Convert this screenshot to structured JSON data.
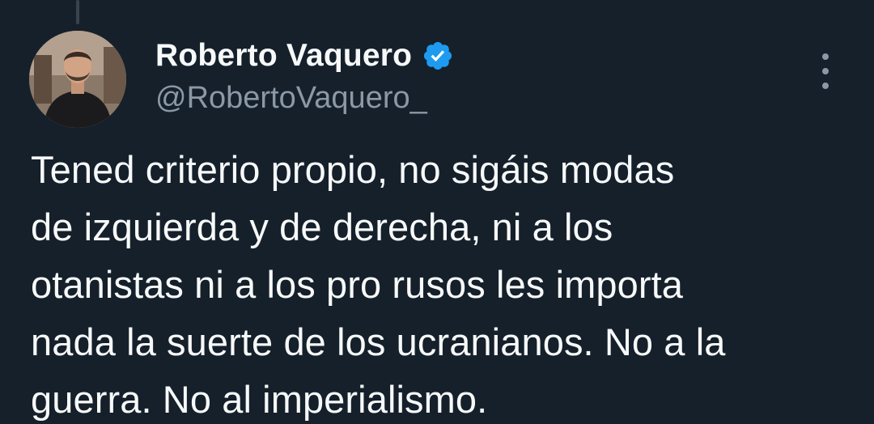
{
  "colors": {
    "background": "#15202b",
    "primary_text": "#f7f9f9",
    "secondary_text": "#8b98a5",
    "verified_badge": "#1d9bf0"
  },
  "author": {
    "display_name": "Roberto Vaquero",
    "handle": "@RobertoVaquero_",
    "verified": true,
    "verified_icon": "verified-badge-icon",
    "avatar_icon": "profile-photo"
  },
  "menu": {
    "icon": "more-options-icon"
  },
  "tweet": {
    "lines": [
      "Tened criterio propio, no sigáis modas",
      "de izquierda y de derecha, ni a los",
      "otanistas ni a los pro rusos les importa",
      "nada la suerte de los ucranianos. No a la",
      "guerra. No al imperialismo."
    ]
  }
}
